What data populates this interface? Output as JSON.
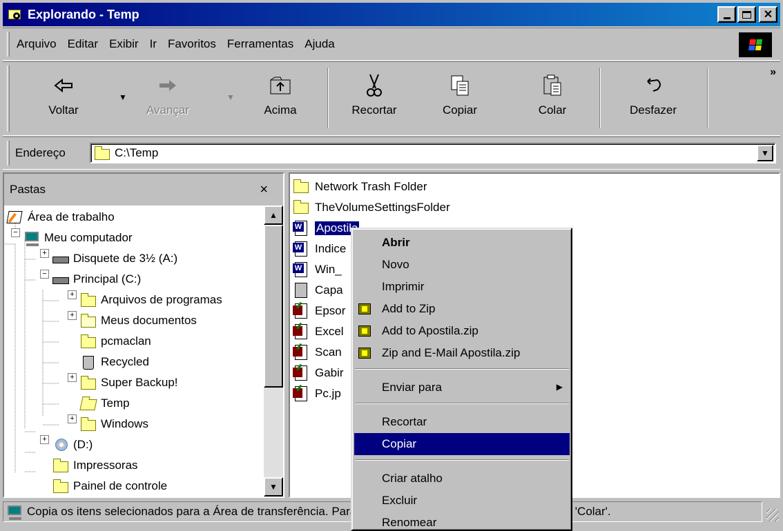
{
  "window": {
    "title": "Explorando - Temp"
  },
  "menubar": {
    "items": [
      "Arquivo",
      "Editar",
      "Exibir",
      "Ir",
      "Favoritos",
      "Ferramentas",
      "Ajuda"
    ]
  },
  "toolbar": {
    "back": "Voltar",
    "forward": "Avançar",
    "up": "Acima",
    "cut": "Recortar",
    "copy": "Copiar",
    "paste": "Colar",
    "undo": "Desfazer",
    "more": "»"
  },
  "address": {
    "label": "Endereço",
    "path": "C:\\Temp"
  },
  "folders": {
    "title": "Pastas",
    "close": "×",
    "tree": [
      {
        "label": "Área de trabalho",
        "icon": "desktop-icon"
      },
      {
        "label": "Meu computador",
        "icon": "computer-icon",
        "expanded": true
      },
      {
        "label": "Disquete de 3½ (A:)",
        "icon": "floppy-drive-icon"
      },
      {
        "label": "Principal (C:)",
        "icon": "hard-drive-icon",
        "expanded": true
      },
      {
        "label": "Arquivos de programas",
        "icon": "folder-icon"
      },
      {
        "label": "Meus documentos",
        "icon": "my-documents-icon"
      },
      {
        "label": "pcmaclan",
        "icon": "folder-icon"
      },
      {
        "label": "Recycled",
        "icon": "recycle-bin-icon"
      },
      {
        "label": "Super Backup!",
        "icon": "folder-icon"
      },
      {
        "label": "Temp",
        "icon": "open-folder-icon",
        "selected": true
      },
      {
        "label": "Windows",
        "icon": "folder-icon"
      },
      {
        "label": "(D:)",
        "icon": "cd-drive-icon"
      },
      {
        "label": "Impressoras",
        "icon": "printers-folder-icon"
      },
      {
        "label": "Painel de controle",
        "icon": "control-panel-icon"
      }
    ]
  },
  "files": [
    {
      "name": "Network Trash Folder",
      "icon": "folder-icon"
    },
    {
      "name": "TheVolumeSettingsFolder",
      "icon": "folder-icon"
    },
    {
      "name": "Apostila.doc",
      "visible": "Apostila",
      "icon": "word-doc-icon",
      "selected": true
    },
    {
      "name": "Indice",
      "icon": "word-doc-icon"
    },
    {
      "name": "Win_",
      "icon": "word-doc-icon"
    },
    {
      "name": "Capa",
      "icon": "image-file-icon"
    },
    {
      "name": "Epsor",
      "icon": "paint-file-icon"
    },
    {
      "name": "Excel",
      "icon": "paint-file-icon"
    },
    {
      "name": "Scan",
      "icon": "paint-file-icon"
    },
    {
      "name": "Gabir",
      "icon": "paint-file-icon"
    },
    {
      "name": "Pc.jp",
      "icon": "paint-file-icon"
    }
  ],
  "context_menu": {
    "items": [
      {
        "label": "Abrir",
        "bold": true
      },
      {
        "label": "Novo"
      },
      {
        "label": "Imprimir"
      },
      {
        "label": "Add to Zip",
        "icon": "winzip-icon"
      },
      {
        "label": "Add to Apostila.zip",
        "icon": "winzip-icon"
      },
      {
        "label": "Zip and E-Mail Apostila.zip",
        "icon": "winzip-icon"
      },
      {
        "label": "Enviar para",
        "submenu": true
      },
      {
        "label": "Recortar"
      },
      {
        "label": "Copiar",
        "highlighted": true
      },
      {
        "label": "Criar atalho"
      },
      {
        "label": "Excluir"
      },
      {
        "label": "Renomear"
      }
    ]
  },
  "status": {
    "text": "Copia os itens selecionados para a Área de transferência. Para colocá-los no novo local, use o comando 'Colar'."
  },
  "colors": {
    "title_start": "#000080",
    "title_end": "#1084d0",
    "selection": "#000080",
    "face": "#c0c0c0"
  }
}
